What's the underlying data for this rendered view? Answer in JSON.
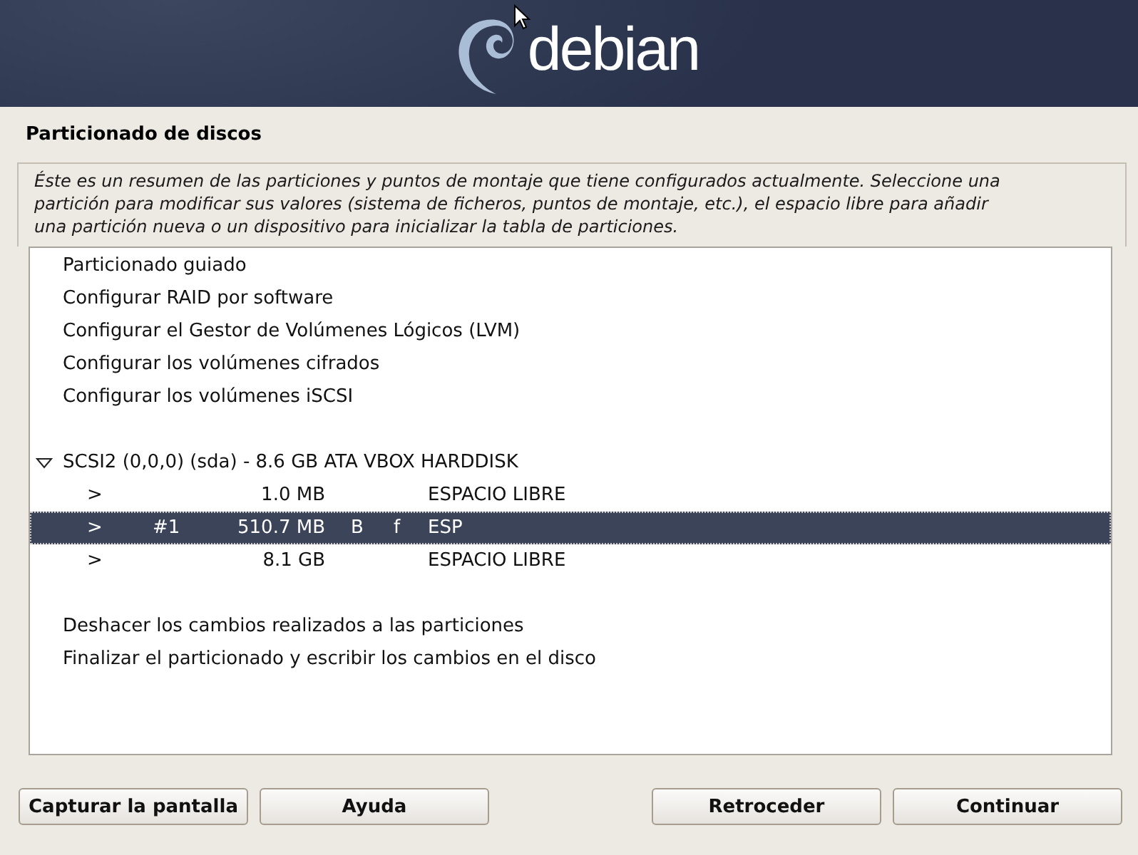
{
  "header": {
    "logo_text": "debian"
  },
  "title": "Particionado de discos",
  "description": "Éste es un resumen de las particiones y puntos de montaje que tiene configurados actualmente. Seleccione una partición para modificar sus valores (sistema de ficheros, puntos de montaje, etc.), el espacio libre para añadir una partición nueva o un dispositivo para inicializar la tabla de particiones.",
  "items": [
    {
      "kind": "action",
      "label": "Particionado guiado",
      "selected": false
    },
    {
      "kind": "action",
      "label": "Configurar RAID por software",
      "selected": false
    },
    {
      "kind": "action",
      "label": "Configurar el Gestor de Volúmenes Lógicos (LVM)",
      "selected": false
    },
    {
      "kind": "action",
      "label": "Configurar los volúmenes cifrados",
      "selected": false
    },
    {
      "kind": "action",
      "label": "Configurar los volúmenes iSCSI",
      "selected": false
    },
    {
      "kind": "blank",
      "selected": false
    },
    {
      "kind": "disk",
      "label": "SCSI2 (0,0,0) (sda) - 8.6 GB ATA VBOX HARDDISK",
      "expanded": true,
      "selected": false
    },
    {
      "kind": "partition",
      "arrow": ">",
      "size": "1.0 MB",
      "name": "ESPACIO LIBRE",
      "selected": false
    },
    {
      "kind": "partition",
      "arrow": ">",
      "number": "#1",
      "size": "510.7 MB",
      "flag_1": "B",
      "flag_2": "f",
      "name": "ESP",
      "selected": true
    },
    {
      "kind": "partition",
      "arrow": ">",
      "size": "8.1 GB",
      "name": "ESPACIO LIBRE",
      "selected": false
    },
    {
      "kind": "blank",
      "selected": false
    },
    {
      "kind": "action",
      "label": "Deshacer los cambios realizados a las particiones",
      "selected": false
    },
    {
      "kind": "action",
      "label": "Finalizar el particionado y escribir los cambios en el disco",
      "selected": false
    }
  ],
  "buttons_left": [
    "Capturar la pantalla",
    "Ayuda"
  ],
  "buttons_right": [
    "Retroceder",
    "Continuar"
  ]
}
